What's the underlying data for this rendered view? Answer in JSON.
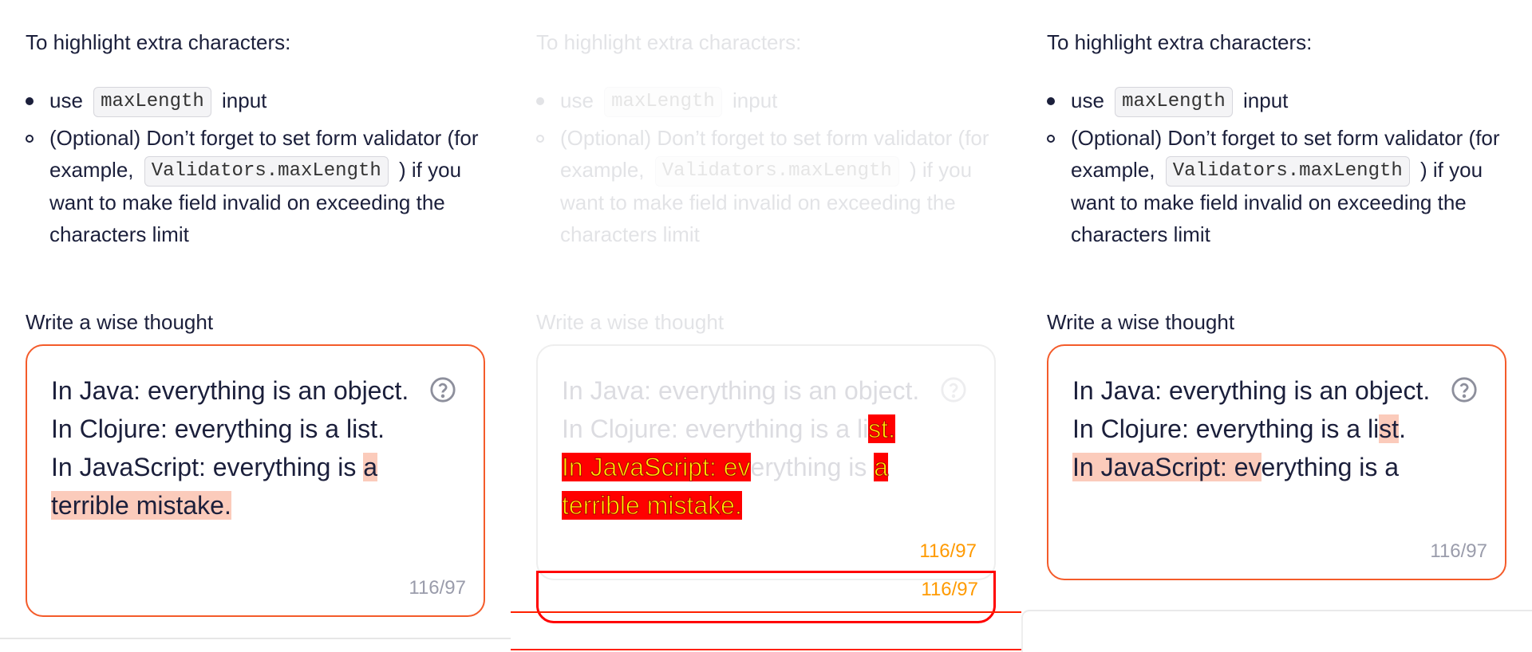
{
  "intro": "To highlight extra characters:",
  "bullets": {
    "item1_pre": "use",
    "item1_code": "maxLength",
    "item1_post": "input",
    "item2_pre": "(Optional) Don’t forget to set form validator (for example,",
    "item2_code": "Validators.maxLength",
    "item2_post": ") if you want to make field invalid on exceeding the characters limit"
  },
  "field_label": "Write a wise thought",
  "textarea": {
    "line1": "In Java: everything is an object.",
    "line2": "In Clojure: everything is a list.",
    "line3_pre": "In JavaScript: everything is",
    "line3_hl": "a",
    "line4_hl": "terrible mistake.",
    "counter": "116/97",
    "help_icon": "question-circle-icon"
  },
  "middle": {
    "line2_pre": "In Clojure: everything is a li",
    "line2_hl": "st.",
    "line3_hl1": "In JavaScript: ev",
    "line3_mid": "erything is",
    "line3_hl2": "a",
    "line4_hl": "terrible mistake.",
    "counter": "116/97",
    "ghost_counter": "116/97"
  },
  "right": {
    "line2_pre": "In Clojure: everything is a li",
    "line2_hl": "st",
    "line2_post": ".",
    "line3_hl": "In JavaScript: ev",
    "line3_post": "erything is a",
    "counter": "116/97"
  },
  "colors": {
    "accent": "#f45b2a",
    "highlight": "#fbcbbb",
    "error_overlay": "#ff0000"
  }
}
